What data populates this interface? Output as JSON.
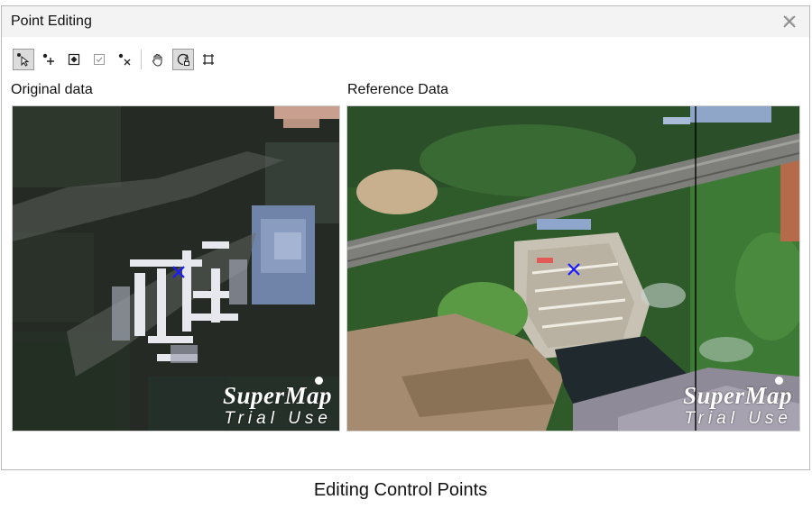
{
  "dialog": {
    "title": "Point Editing"
  },
  "toolbar": {
    "tools": [
      {
        "name": "select-tool",
        "icon": "select-cursor-icon",
        "active": true
      },
      {
        "name": "add-point-tool",
        "icon": "add-point-icon",
        "active": false
      },
      {
        "name": "edit-point-tool",
        "icon": "edit-point-icon",
        "active": false
      },
      {
        "name": "check-tool",
        "icon": "checkbox-icon",
        "active": false
      },
      {
        "name": "delete-point-tool",
        "icon": "delete-point-icon",
        "active": false
      },
      {
        "name": "pan-tool",
        "icon": "hand-icon",
        "active": false
      },
      {
        "name": "lock-view-tool",
        "icon": "lock-view-icon",
        "active": true
      },
      {
        "name": "full-extent-tool",
        "icon": "full-extent-icon",
        "active": false
      }
    ]
  },
  "panels": {
    "original": {
      "label": "Original data"
    },
    "reference": {
      "label": "Reference Data"
    }
  },
  "watermark": {
    "brand": "SuperMap",
    "sub": "Trial Use"
  },
  "caption": "Editing Control Points",
  "colors": {
    "marker": "#1a1aff",
    "titlebar": "#f3f3f3",
    "border": "#b9b9b9"
  }
}
